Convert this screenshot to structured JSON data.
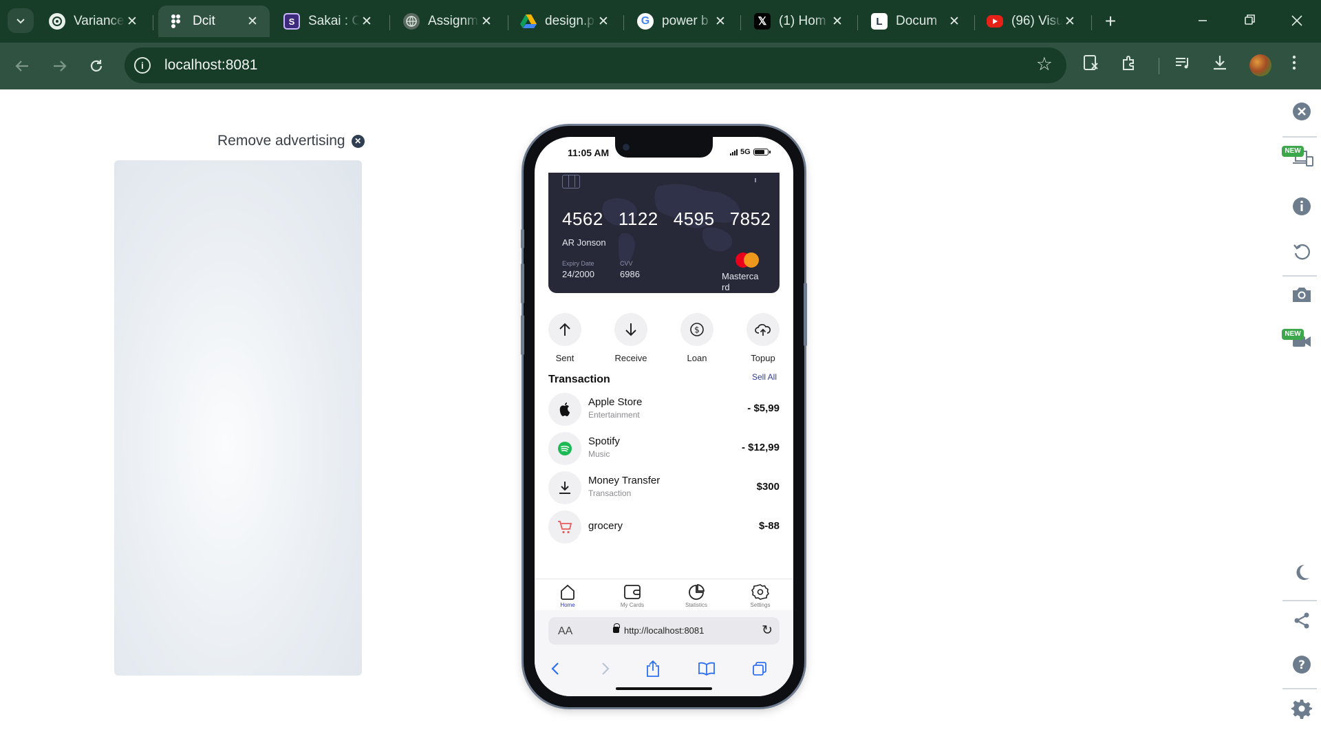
{
  "browser": {
    "tabs": [
      {
        "title": "Variance",
        "favicon": "openai-icon",
        "color": "#e9efe9"
      },
      {
        "title": "Dcit",
        "favicon": "figma-icon",
        "color": "#e9efe9",
        "active": true
      },
      {
        "title": "Sakai : C",
        "favicon": "sakai-icon",
        "color": "#3e2a7d"
      },
      {
        "title": "Assignm",
        "favicon": "globe-icon",
        "color": "#5b6b62"
      },
      {
        "title": "design.p",
        "favicon": "google-drive-icon",
        "color": "#f4b400"
      },
      {
        "title": "power b",
        "favicon": "google-icon",
        "color": "#ffffff"
      },
      {
        "title": "(1) Hom",
        "favicon": "x-icon",
        "color": "#000000"
      },
      {
        "title": "Docum",
        "favicon": "document-icon",
        "color": "#1e2f45"
      },
      {
        "title": "(96) Visu",
        "favicon": "youtube-icon",
        "color": "#e62117"
      }
    ],
    "new_tab_label": "+",
    "url": "localhost:8081"
  },
  "ad": {
    "label": "Remove advertising"
  },
  "phone": {
    "status_time": "11:05 AM",
    "network": "5G",
    "card": {
      "number_groups": [
        "4562",
        "1122",
        "4595",
        "7852"
      ],
      "holder": "AR Jonson",
      "expiry_label": "Expiry Date",
      "expiry_value": "24/2000",
      "cvv_label": "CVV",
      "cvv_value": "6986",
      "brand": "Mastercard",
      "background": "#272838"
    },
    "actions": [
      {
        "label": "Sent",
        "icon": "arrow-up-icon"
      },
      {
        "label": "Receive",
        "icon": "arrow-down-icon"
      },
      {
        "label": "Loan",
        "icon": "dollar-icon"
      },
      {
        "label": "Topup",
        "icon": "cloud-upload-icon"
      }
    ],
    "transactions_title": "Transaction",
    "see_all_label": "Sell All",
    "transactions": [
      {
        "name": "Apple Store",
        "category": "Entertainment",
        "amount": "- $5,99",
        "icon": "apple-icon"
      },
      {
        "name": "Spotify",
        "category": "Music",
        "amount": "- $12,99",
        "icon": "spotify-icon"
      },
      {
        "name": "Money Transfer",
        "category": "Transaction",
        "amount": "$300",
        "icon": "download-icon"
      },
      {
        "name": "grocery",
        "category": "",
        "amount": "$-88",
        "icon": "cart-icon"
      }
    ],
    "tabbar": [
      {
        "label": "Home",
        "icon": "home-icon",
        "active": true
      },
      {
        "label": "My Cards",
        "icon": "wallet-icon"
      },
      {
        "label": "Statistics",
        "icon": "pie-chart-icon"
      },
      {
        "label": "Settings",
        "icon": "settings-icon"
      }
    ],
    "safari": {
      "aa_label": "AA",
      "url": "http://localhost:8081"
    }
  },
  "side_panel": {
    "new_badge": "NEW",
    "accent": "#3ca84b"
  }
}
